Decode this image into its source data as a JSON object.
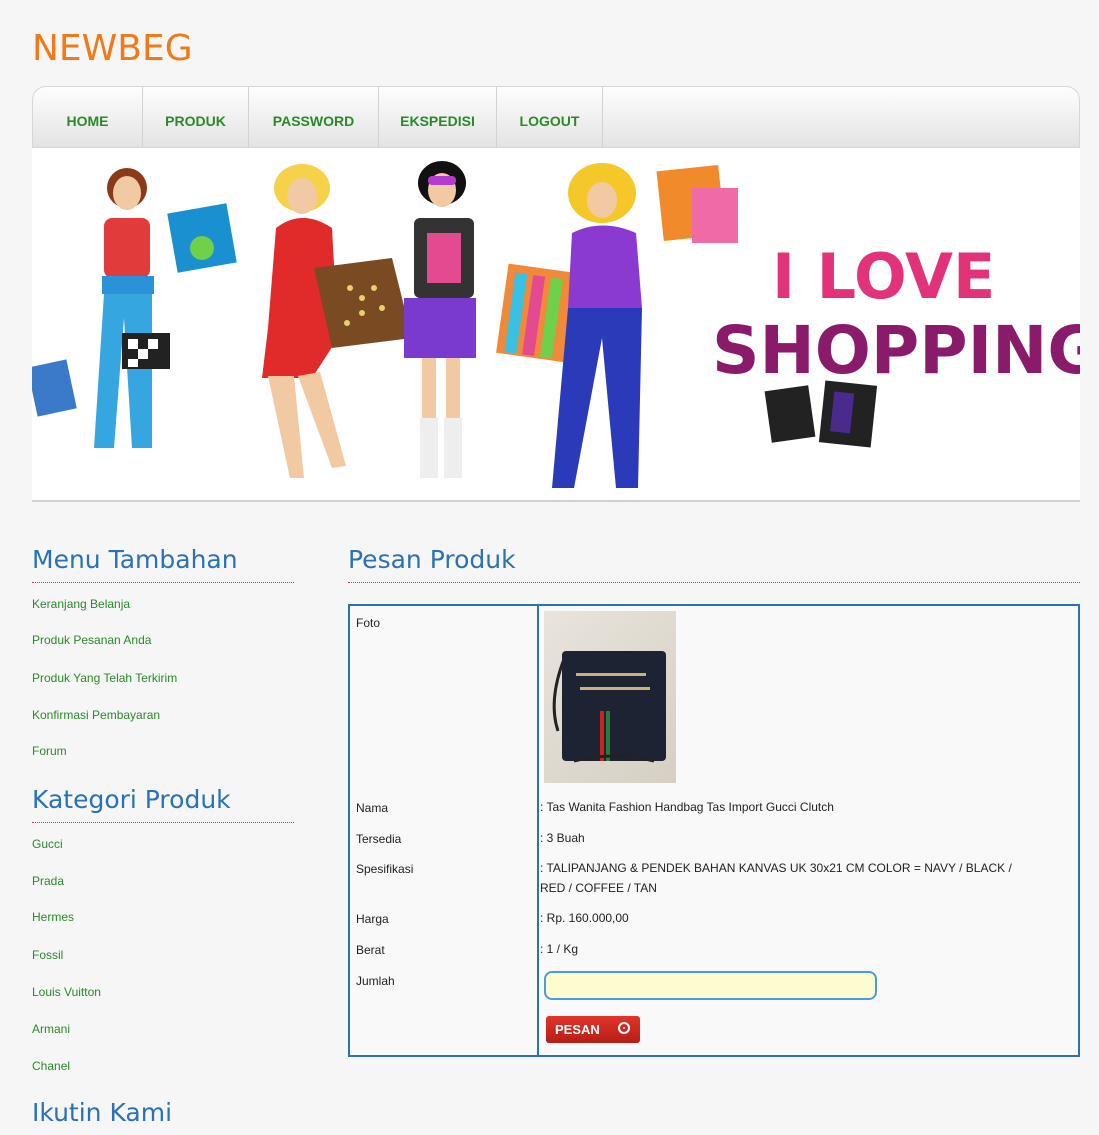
{
  "site": {
    "logo": "NEWBEG"
  },
  "nav": {
    "items": [
      {
        "label": "HOME"
      },
      {
        "label": "PRODUK"
      },
      {
        "label": "PASSWORD"
      },
      {
        "label": "EKSPEDISI"
      },
      {
        "label": "LOGOUT"
      }
    ]
  },
  "banner": {
    "line1": "I LOVE",
    "line2": "SHOPPING"
  },
  "sidebar": {
    "menu_title": "Menu Tambahan",
    "menu_items": [
      {
        "label": "Keranjang Belanja"
      },
      {
        "label": "Produk Pesanan Anda"
      },
      {
        "label": "Produk Yang Telah Terkirim"
      },
      {
        "label": "Konfirmasi Pembayaran"
      },
      {
        "label": "Forum"
      }
    ],
    "category_title": "Kategori Produk",
    "categories": [
      {
        "label": "Gucci"
      },
      {
        "label": "Prada"
      },
      {
        "label": "Hermes"
      },
      {
        "label": "Fossil"
      },
      {
        "label": "Louis Vuitton"
      },
      {
        "label": "Armani"
      },
      {
        "label": "Chanel"
      }
    ],
    "follow_title": "Ikutin Kami"
  },
  "main": {
    "title": "Pesan Produk",
    "labels": {
      "foto": "Foto",
      "nama": "Nama",
      "tersedia": "Tersedia",
      "spesifikasi": "Spesifikasi",
      "harga": "Harga",
      "berat": "Berat",
      "jumlah": "Jumlah"
    },
    "values": {
      "nama": ": Tas Wanita Fashion Handbag Tas Import Gucci Clutch",
      "tersedia": ": 3 Buah",
      "spesifikasi_1": ": TALIPANJANG & PENDEK BAHAN KANVAS UK 30x21 CM COLOR = NAVY / BLACK /",
      "spesifikasi_2": "RED / COFFEE / TAN",
      "harga": ": Rp. 160.000,00",
      "berat": ": 1 / Kg"
    },
    "jumlah_value": "",
    "button_label": "PESAN"
  },
  "colors": {
    "accent": "#f07a1a",
    "link": "#2a8a2a",
    "heading": "#2a72b5",
    "button": "#d42a20"
  }
}
